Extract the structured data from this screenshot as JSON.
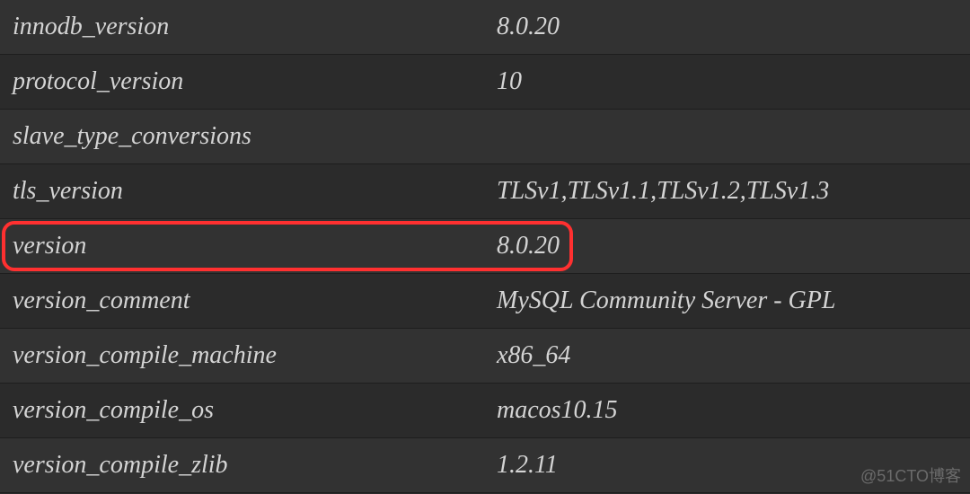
{
  "rows": [
    {
      "key": "innodb_version",
      "value": "8.0.20",
      "highlighted": false
    },
    {
      "key": "protocol_version",
      "value": "10",
      "highlighted": false
    },
    {
      "key": "slave_type_conversions",
      "value": "",
      "highlighted": false
    },
    {
      "key": "tls_version",
      "value": "TLSv1,TLSv1.1,TLSv1.2,TLSv1.3",
      "highlighted": false
    },
    {
      "key": "version",
      "value": "8.0.20",
      "highlighted": true
    },
    {
      "key": "version_comment",
      "value": "MySQL Community Server - GPL",
      "highlighted": false
    },
    {
      "key": "version_compile_machine",
      "value": "x86_64",
      "highlighted": false
    },
    {
      "key": "version_compile_os",
      "value": "macos10.15",
      "highlighted": false
    },
    {
      "key": "version_compile_zlib",
      "value": "1.2.11",
      "highlighted": false
    }
  ],
  "watermark": "@51CTO博客"
}
